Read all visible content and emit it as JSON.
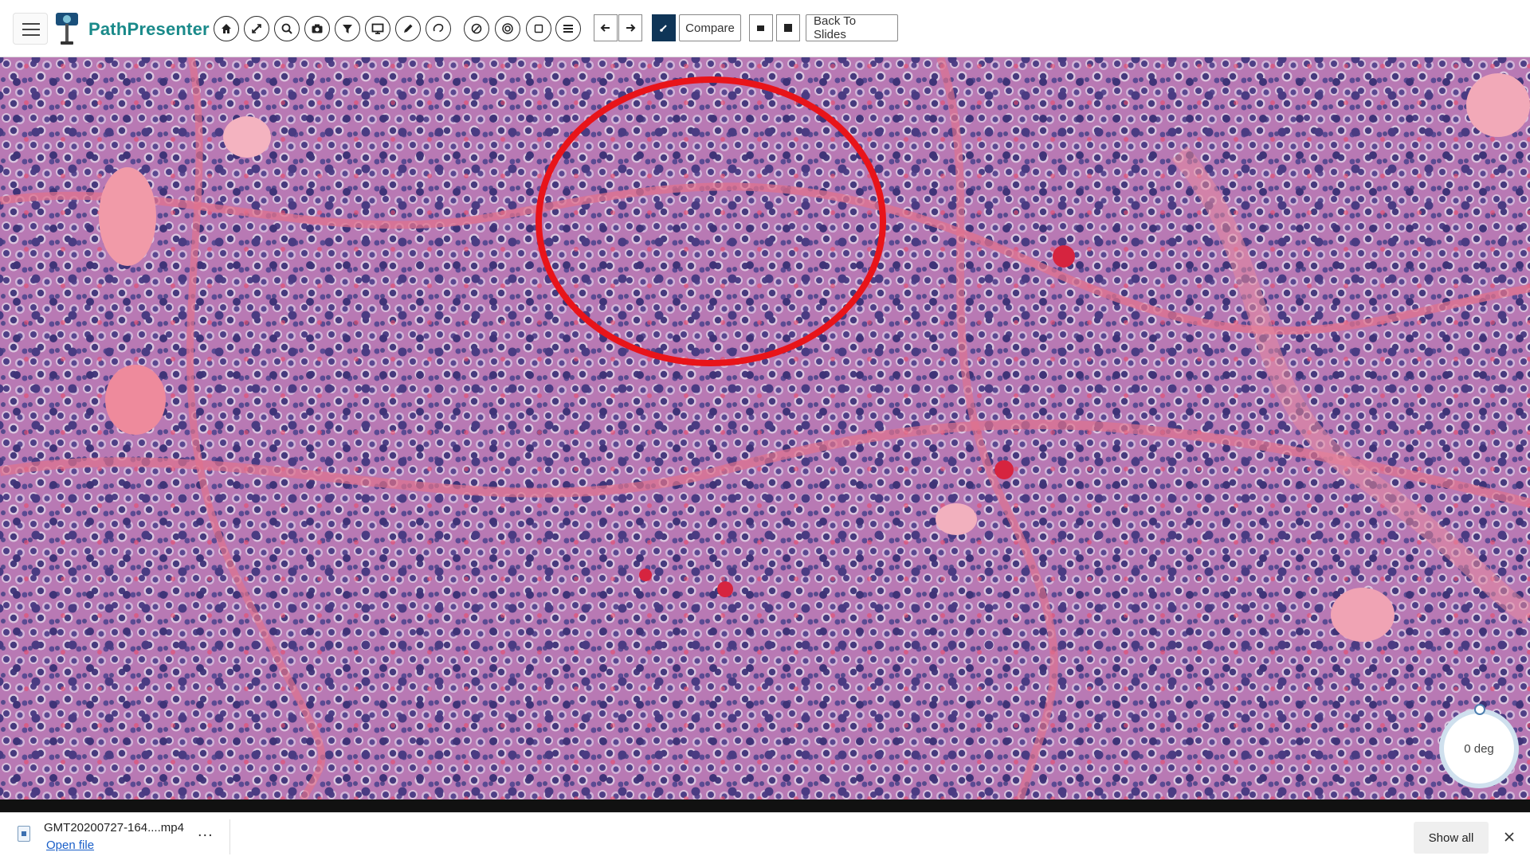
{
  "app": {
    "name": "PathPresenter"
  },
  "toolbar": {
    "icons": [
      "home-icon",
      "measure-icon",
      "zoom-icon",
      "camera-icon",
      "filter-icon",
      "monitor-icon",
      "pen-icon",
      "lasso-icon",
      "draw-circle-icon",
      "concentric-circle-icon",
      "square-icon",
      "list-icon"
    ],
    "prev_icon": "arrow-left-icon",
    "next_icon": "arrow-right-icon",
    "compare_label": "Compare",
    "back_label": "Back To Slides"
  },
  "viewer": {
    "rotation_label": "0 deg",
    "annotation_color": "#e8141a"
  },
  "downloads": {
    "file_name": "GMT20200727-164....mp4",
    "open_label": "Open file",
    "more_label": "...",
    "show_all_label": "Show all"
  }
}
